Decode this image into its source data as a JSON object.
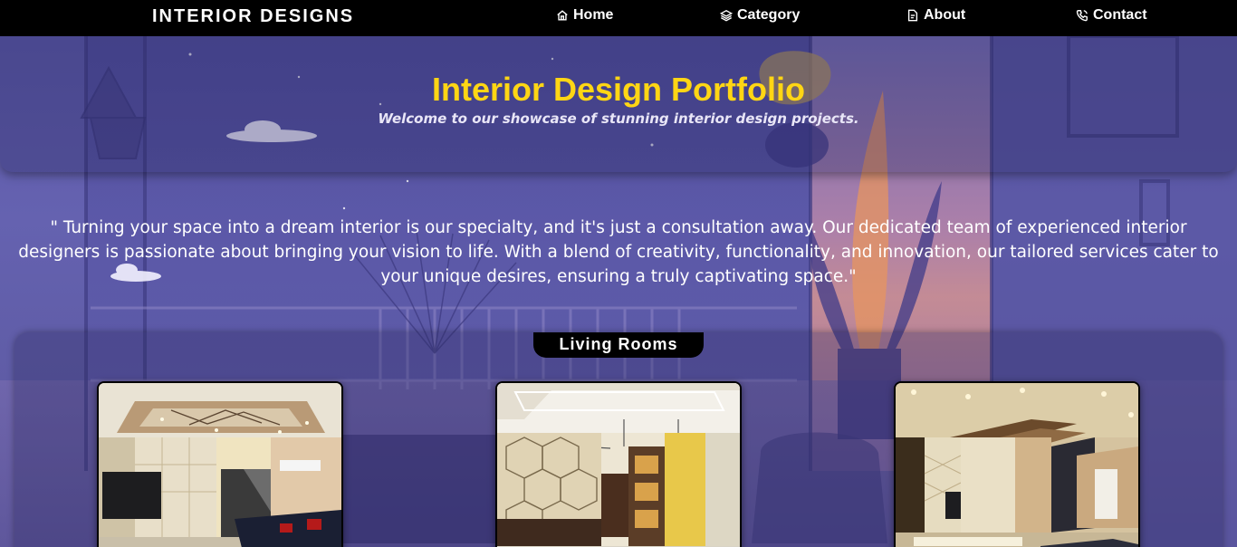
{
  "navbar": {
    "brand": "INTERIOR DESIGNS",
    "links": [
      {
        "label": "Home",
        "icon": "home-icon"
      },
      {
        "label": "Category",
        "icon": "layers-icon"
      },
      {
        "label": "About",
        "icon": "document-icon"
      },
      {
        "label": "Contact",
        "icon": "phone-icon"
      }
    ]
  },
  "hero": {
    "title": "Interior Design Portfolio",
    "subtitle": "Welcome to our showcase of stunning interior design projects."
  },
  "quote": "\" Turning your space into a dream interior is our specialty, and it's just a consultation away. Our dedicated team of experienced interior designers is passionate about bringing your vision to life. With a blend of creativity, functionality, and innovation, our tailored services cater to your unique desires, ensuring a truly captivating space.\"",
  "gallery": {
    "section_title": "Living Rooms"
  },
  "colors": {
    "title_yellow": "#ffd614",
    "nav_bg": "#000000",
    "page_bg": "#5b58a6"
  }
}
